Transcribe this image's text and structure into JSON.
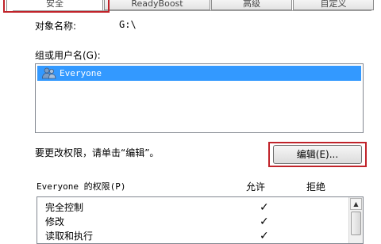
{
  "tabs": [
    {
      "label": "安全",
      "active": true
    },
    {
      "label": "ReadyBoost",
      "active": false
    },
    {
      "label": "高级",
      "active": false
    },
    {
      "label": "自定义",
      "active": false
    }
  ],
  "object": {
    "label": "对象名称:",
    "value": "G:\\"
  },
  "group_label": "组或用户名(G):",
  "users": [
    {
      "name": "Everyone",
      "icon": "users-icon"
    }
  ],
  "change_hint": "要更改权限，请单击“编辑”。",
  "edit_button": "编辑(E)...",
  "permissions": {
    "header": "Everyone 的权限(P)",
    "allow_col": "允许",
    "deny_col": "拒绝",
    "rows": [
      {
        "name": "完全控制",
        "allow": "✓",
        "deny": ""
      },
      {
        "name": "修改",
        "allow": "✓",
        "deny": ""
      },
      {
        "name": "读取和执行",
        "allow": "✓",
        "deny": ""
      }
    ]
  },
  "colors": {
    "highlight": "#c0232a",
    "selection": "#3399ff"
  }
}
